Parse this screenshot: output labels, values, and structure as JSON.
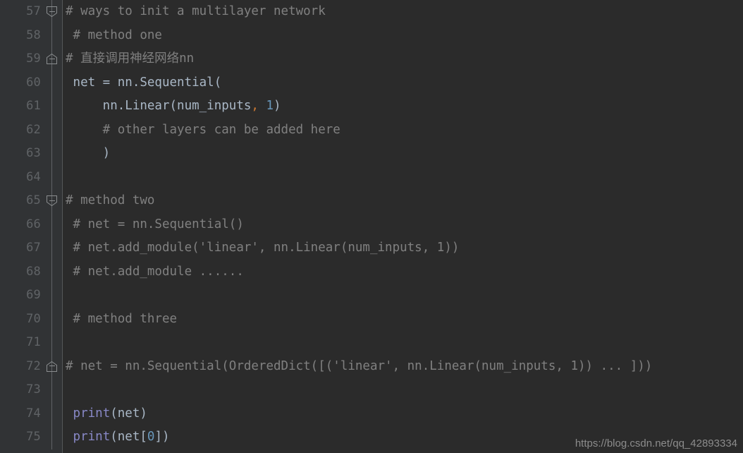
{
  "editor": {
    "theme_name": "darcula",
    "colors": {
      "editor_background": "#2b2b2b",
      "gutter_background": "#313335",
      "gutter_rule": "#555759",
      "line_number": "#606366",
      "comment": "#808080",
      "code_default": "#a9b7c6",
      "number_literal": "#6897bb",
      "operator_comma": "#cc7832",
      "builtin_function": "#8888c6",
      "fold_marker": "#8a8d8f",
      "watermark": "#8c8c8c"
    },
    "first_line_number": 57,
    "last_line_number": 75,
    "lines": [
      {
        "number": "57",
        "fold": "end",
        "tokens": [
          {
            "text": "# ways to init a multilayer network",
            "cls": "cmt"
          }
        ]
      },
      {
        "number": "58",
        "fold": "none",
        "tokens": [
          {
            "text": " # method one",
            "cls": "cmt"
          }
        ]
      },
      {
        "number": "59",
        "fold": "start",
        "tokens": [
          {
            "text": "# 直接调用神经网络nn",
            "cls": "cmt"
          }
        ]
      },
      {
        "number": "60",
        "fold": "none",
        "tokens": [
          {
            "text": " net = nn.Sequential(",
            "cls": "code"
          }
        ]
      },
      {
        "number": "61",
        "fold": "none",
        "tokens": [
          {
            "text": "     nn.Linear(num_inputs",
            "cls": "code"
          },
          {
            "text": ",",
            "cls": "comma"
          },
          {
            "text": " ",
            "cls": "code"
          },
          {
            "text": "1",
            "cls": "num"
          },
          {
            "text": ")",
            "cls": "code"
          }
        ]
      },
      {
        "number": "62",
        "fold": "none",
        "tokens": [
          {
            "text": "     # other layers can be added here",
            "cls": "cmt"
          }
        ]
      },
      {
        "number": "63",
        "fold": "none",
        "tokens": [
          {
            "text": "     )",
            "cls": "code"
          }
        ]
      },
      {
        "number": "64",
        "fold": "none",
        "tokens": []
      },
      {
        "number": "65",
        "fold": "end",
        "tokens": [
          {
            "text": "# method two",
            "cls": "cmt"
          }
        ]
      },
      {
        "number": "66",
        "fold": "none",
        "tokens": [
          {
            "text": " # net = nn.Sequential()",
            "cls": "cmt"
          }
        ]
      },
      {
        "number": "67",
        "fold": "none",
        "tokens": [
          {
            "text": " # net.add_module('linear', nn.Linear(num_inputs, 1))",
            "cls": "cmt"
          }
        ]
      },
      {
        "number": "68",
        "fold": "none",
        "tokens": [
          {
            "text": " # net.add_module ......",
            "cls": "cmt"
          }
        ]
      },
      {
        "number": "69",
        "fold": "none",
        "tokens": []
      },
      {
        "number": "70",
        "fold": "none",
        "tokens": [
          {
            "text": " # method three",
            "cls": "cmt"
          }
        ]
      },
      {
        "number": "71",
        "fold": "none",
        "tokens": []
      },
      {
        "number": "72",
        "fold": "start",
        "tokens": [
          {
            "text": "# net = nn.Sequential(OrderedDict([('linear', nn.Linear(num_inputs, 1)) ... ]))",
            "cls": "cmt"
          }
        ]
      },
      {
        "number": "73",
        "fold": "none",
        "tokens": []
      },
      {
        "number": "74",
        "fold": "none",
        "tokens": [
          {
            "text": " ",
            "cls": "code"
          },
          {
            "text": "print",
            "cls": "bfn"
          },
          {
            "text": "(net)",
            "cls": "code"
          }
        ]
      },
      {
        "number": "75",
        "fold": "none",
        "tokens": [
          {
            "text": " ",
            "cls": "code"
          },
          {
            "text": "print",
            "cls": "bfn"
          },
          {
            "text": "(net[",
            "cls": "code"
          },
          {
            "text": "0",
            "cls": "num"
          },
          {
            "text": "])",
            "cls": "code"
          }
        ]
      }
    ]
  },
  "watermark": {
    "text": "https://blog.csdn.net/qq_42893334"
  }
}
